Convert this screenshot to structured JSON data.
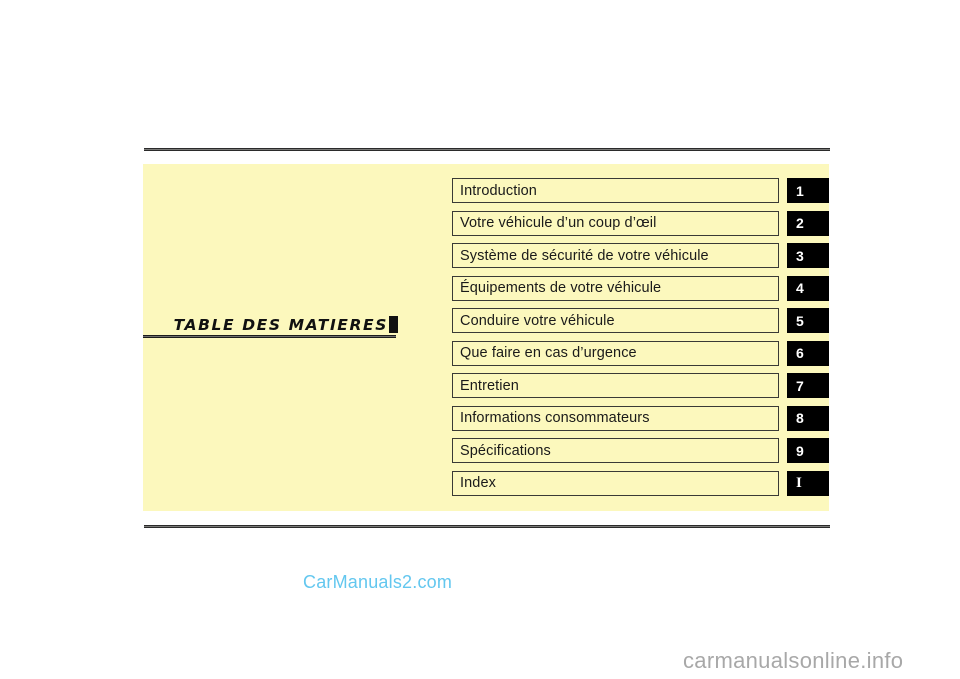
{
  "page": {
    "background_color": "#ffffff",
    "panel_color": "#fcf8bd"
  },
  "title_block": {
    "text": "TABLE  DES  MATIERES",
    "caret_icon": "black-square-marker"
  },
  "toc": {
    "items": [
      {
        "label": "Introduction",
        "number": "1"
      },
      {
        "label": "Votre véhicule d’un coup d’œil",
        "number": "2"
      },
      {
        "label": "Système de sécurité de votre véhicule",
        "number": "3"
      },
      {
        "label": "Équipements de votre véhicule",
        "number": "4"
      },
      {
        "label": "Conduire votre véhicule",
        "number": "5"
      },
      {
        "label": "Que faire en cas d’urgence",
        "number": "6"
      },
      {
        "label": "Entretien",
        "number": "7"
      },
      {
        "label": "Informations consommateurs",
        "number": "8"
      },
      {
        "label": "Spécifications",
        "number": "9"
      },
      {
        "label": "Index",
        "number": "I"
      }
    ]
  },
  "watermarks": {
    "center": "CarManuals2.com",
    "center_color": "#63c7ef",
    "corner": "carmanualsonline.info",
    "corner_color": "#a8a8a8"
  }
}
